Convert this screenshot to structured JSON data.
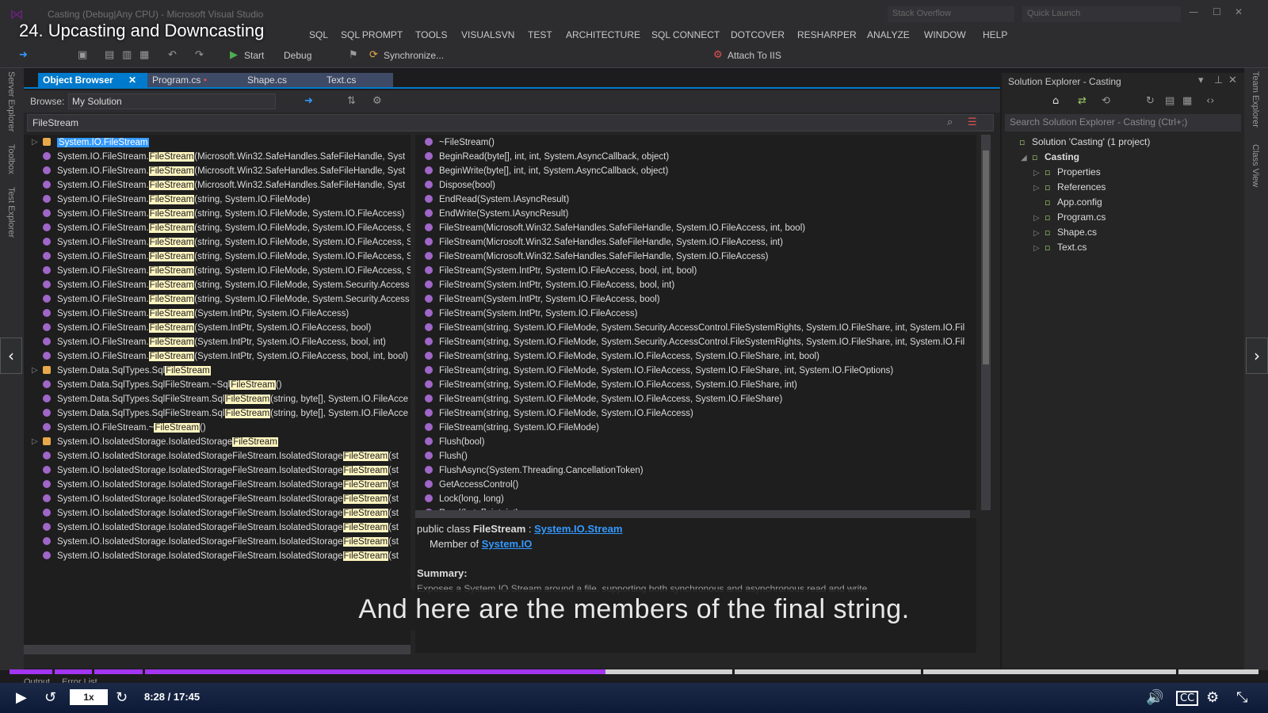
{
  "window_title": "Casting (Debug|Any CPU) - Microsoft Visual Studio",
  "video_title": "24. Upcasting and Downcasting",
  "top_bar": {
    "stackoverflow": "Stack Overflow",
    "quick_launch": "Quick Launch"
  },
  "menu": [
    "SQL",
    "SQL PROMPT",
    "TOOLS",
    "VISUALSVN",
    "TEST",
    "ARCHITECTURE",
    "SQL CONNECT",
    "DOTCOVER",
    "RESHARPER",
    "ANALYZE",
    "WINDOW",
    "HELP"
  ],
  "toolbar": {
    "start": "Start",
    "debug": "Debug",
    "synchronize": "Synchronize...",
    "attach": "Attach To IIS"
  },
  "side_tabs": {
    "left": [
      "Server Explorer",
      "Toolbox",
      "Test Explorer"
    ],
    "right": [
      "Team Explorer",
      "Class View"
    ]
  },
  "tabs": {
    "object_browser": "Object Browser",
    "program": "Program.cs",
    "shape": "Shape.cs",
    "text": "Text.cs"
  },
  "browse": {
    "label": "Browse:",
    "value": "My Solution"
  },
  "search": {
    "value": "FileStream"
  },
  "objects": [
    {
      "pre": "",
      "hl": "System.IO.FileStream",
      "post": "",
      "kind": "class",
      "sel": true,
      "arrow": true
    },
    {
      "pre": "System.IO.FileStream.",
      "hl": "FileStream",
      "post": "(Microsoft.Win32.SafeHandles.SafeFileHandle, Syst"
    },
    {
      "pre": "System.IO.FileStream.",
      "hl": "FileStream",
      "post": "(Microsoft.Win32.SafeHandles.SafeFileHandle, Syst"
    },
    {
      "pre": "System.IO.FileStream.",
      "hl": "FileStream",
      "post": "(Microsoft.Win32.SafeHandles.SafeFileHandle, Syst"
    },
    {
      "pre": "System.IO.FileStream.",
      "hl": "FileStream",
      "post": "(string, System.IO.FileMode)"
    },
    {
      "pre": "System.IO.FileStream.",
      "hl": "FileStream",
      "post": "(string, System.IO.FileMode, System.IO.FileAccess)"
    },
    {
      "pre": "System.IO.FileStream.",
      "hl": "FileStream",
      "post": "(string, System.IO.FileMode, System.IO.FileAccess, S"
    },
    {
      "pre": "System.IO.FileStream.",
      "hl": "FileStream",
      "post": "(string, System.IO.FileMode, System.IO.FileAccess, S"
    },
    {
      "pre": "System.IO.FileStream.",
      "hl": "FileStream",
      "post": "(string, System.IO.FileMode, System.IO.FileAccess, S"
    },
    {
      "pre": "System.IO.FileStream.",
      "hl": "FileStream",
      "post": "(string, System.IO.FileMode, System.IO.FileAccess, S"
    },
    {
      "pre": "System.IO.FileStream.",
      "hl": "FileStream",
      "post": "(string, System.IO.FileMode, System.Security.Access"
    },
    {
      "pre": "System.IO.FileStream.",
      "hl": "FileStream",
      "post": "(string, System.IO.FileMode, System.Security.Access"
    },
    {
      "pre": "System.IO.FileStream.",
      "hl": "FileStream",
      "post": "(System.IntPtr, System.IO.FileAccess)"
    },
    {
      "pre": "System.IO.FileStream.",
      "hl": "FileStream",
      "post": "(System.IntPtr, System.IO.FileAccess, bool)"
    },
    {
      "pre": "System.IO.FileStream.",
      "hl": "FileStream",
      "post": "(System.IntPtr, System.IO.FileAccess, bool, int)"
    },
    {
      "pre": "System.IO.FileStream.",
      "hl": "FileStream",
      "post": "(System.IntPtr, System.IO.FileAccess, bool, int, bool)"
    },
    {
      "pre": "System.Data.SqlTypes.Sql",
      "hl": "FileStream",
      "post": "",
      "kind": "class",
      "arrow": true
    },
    {
      "pre": "System.Data.SqlTypes.SqlFileStream.~Sql",
      "hl": "FileStream",
      "post": "()"
    },
    {
      "pre": "System.Data.SqlTypes.SqlFileStream.Sql",
      "hl": "FileStream",
      "post": "(string, byte[], System.IO.FileAcce"
    },
    {
      "pre": "System.Data.SqlTypes.SqlFileStream.Sql",
      "hl": "FileStream",
      "post": "(string, byte[], System.IO.FileAcce"
    },
    {
      "pre": "System.IO.FileStream.~",
      "hl": "FileStream",
      "post": "()"
    },
    {
      "pre": "System.IO.IsolatedStorage.IsolatedStorage",
      "hl": "FileStream",
      "post": "",
      "kind": "class",
      "arrow": true
    },
    {
      "pre": "System.IO.IsolatedStorage.IsolatedStorageFileStream.IsolatedStorage",
      "hl": "FileStream",
      "post": "(st"
    },
    {
      "pre": "System.IO.IsolatedStorage.IsolatedStorageFileStream.IsolatedStorage",
      "hl": "FileStream",
      "post": "(st"
    },
    {
      "pre": "System.IO.IsolatedStorage.IsolatedStorageFileStream.IsolatedStorage",
      "hl": "FileStream",
      "post": "(st"
    },
    {
      "pre": "System.IO.IsolatedStorage.IsolatedStorageFileStream.IsolatedStorage",
      "hl": "FileStream",
      "post": "(st"
    },
    {
      "pre": "System.IO.IsolatedStorage.IsolatedStorageFileStream.IsolatedStorage",
      "hl": "FileStream",
      "post": "(st"
    },
    {
      "pre": "System.IO.IsolatedStorage.IsolatedStorageFileStream.IsolatedStorage",
      "hl": "FileStream",
      "post": "(st"
    },
    {
      "pre": "System.IO.IsolatedStorage.IsolatedStorageFileStream.IsolatedStorage",
      "hl": "FileStream",
      "post": "(st"
    },
    {
      "pre": "System.IO.IsolatedStorage.IsolatedStorageFileStream.IsolatedStorage",
      "hl": "FileStream",
      "post": "(st"
    }
  ],
  "members": [
    "~FileStream()",
    "BeginRead(byte[], int, int, System.AsyncCallback, object)",
    "BeginWrite(byte[], int, int, System.AsyncCallback, object)",
    "Dispose(bool)",
    "EndRead(System.IAsyncResult)",
    "EndWrite(System.IAsyncResult)",
    "FileStream(Microsoft.Win32.SafeHandles.SafeFileHandle, System.IO.FileAccess, int, bool)",
    "FileStream(Microsoft.Win32.SafeHandles.SafeFileHandle, System.IO.FileAccess, int)",
    "FileStream(Microsoft.Win32.SafeHandles.SafeFileHandle, System.IO.FileAccess)",
    "FileStream(System.IntPtr, System.IO.FileAccess, bool, int, bool)",
    "FileStream(System.IntPtr, System.IO.FileAccess, bool, int)",
    "FileStream(System.IntPtr, System.IO.FileAccess, bool)",
    "FileStream(System.IntPtr, System.IO.FileAccess)",
    "FileStream(string, System.IO.FileMode, System.Security.AccessControl.FileSystemRights, System.IO.FileShare, int, System.IO.Fil",
    "FileStream(string, System.IO.FileMode, System.Security.AccessControl.FileSystemRights, System.IO.FileShare, int, System.IO.Fil",
    "FileStream(string, System.IO.FileMode, System.IO.FileAccess, System.IO.FileShare, int, bool)",
    "FileStream(string, System.IO.FileMode, System.IO.FileAccess, System.IO.FileShare, int, System.IO.FileOptions)",
    "FileStream(string, System.IO.FileMode, System.IO.FileAccess, System.IO.FileShare, int)",
    "FileStream(string, System.IO.FileMode, System.IO.FileAccess, System.IO.FileShare)",
    "FileStream(string, System.IO.FileMode, System.IO.FileAccess)",
    "FileStream(string, System.IO.FileMode)",
    "Flush(bool)",
    "Flush()",
    "FlushAsync(System.Threading.CancellationToken)",
    "GetAccessControl()",
    "Lock(long, long)",
    "Read(byte[], int, int)"
  ],
  "description": {
    "decl_prefix": "public class ",
    "decl_name": "FileStream",
    "decl_sep": " : ",
    "decl_base": "System.IO.Stream",
    "member_of_label": "Member of ",
    "member_of_link": "System.IO",
    "summary_label": "Summary:",
    "summary_text": "Exposes a System.IO.Stream around a file, supporting both synchronous and asynchronous read and write"
  },
  "solution_explorer": {
    "title": "Solution Explorer - Casting",
    "search_placeholder": "Search Solution Explorer - Casting (Ctrl+;)",
    "items": [
      {
        "label": "Solution 'Casting' (1 project)",
        "level": 0,
        "exp": ""
      },
      {
        "label": "Casting",
        "level": 1,
        "exp": "◢",
        "bold": true
      },
      {
        "label": "Properties",
        "level": 2,
        "exp": "▷"
      },
      {
        "label": "References",
        "level": 2,
        "exp": "▷"
      },
      {
        "label": "App.config",
        "level": 2,
        "exp": ""
      },
      {
        "label": "Program.cs",
        "level": 2,
        "exp": "▷"
      },
      {
        "label": "Shape.cs",
        "level": 2,
        "exp": "▷"
      },
      {
        "label": "Text.cs",
        "level": 2,
        "exp": "▷"
      }
    ]
  },
  "bottom_tabs": {
    "output": "Output",
    "error_list": "Error List"
  },
  "caption": "And here are the members of the final string.",
  "player": {
    "speed": "1x",
    "time": "8:28 / 17:45",
    "progress": 0.477
  },
  "colors": {
    "accent": "#007acc",
    "progress": "#a435f0",
    "highlight": "#fff5c0"
  },
  "icons": [
    "play-icon",
    "rewind-icon",
    "forward-icon",
    "volume-icon",
    "captions-icon",
    "settings-icon",
    "fullscreen-icon",
    "prev-icon",
    "next-icon"
  ]
}
